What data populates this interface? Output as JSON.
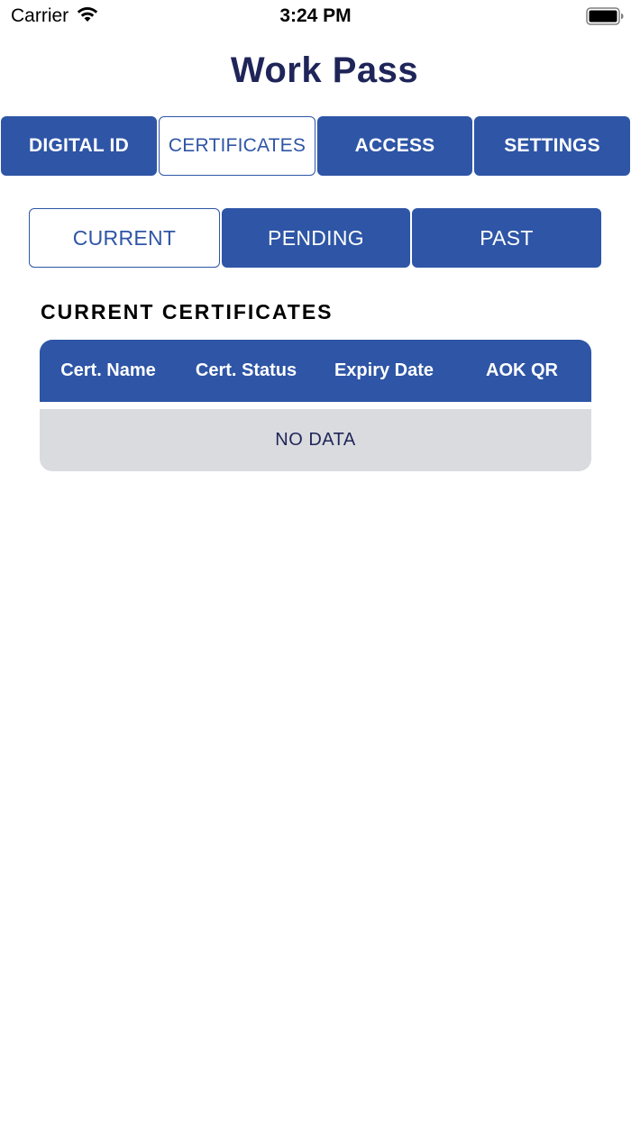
{
  "status_bar": {
    "carrier": "Carrier",
    "time": "3:24 PM",
    "wifi_icon": "wifi-icon",
    "battery_icon": "battery-icon"
  },
  "header": {
    "title": "Work Pass"
  },
  "main_tabs": [
    {
      "label": "DIGITAL ID",
      "active": false
    },
    {
      "label": "CERTIFICATES",
      "active": true
    },
    {
      "label": "ACCESS",
      "active": false
    },
    {
      "label": "SETTINGS",
      "active": false
    }
  ],
  "sub_tabs": [
    {
      "label": "CURRENT",
      "active": true
    },
    {
      "label": "PENDING",
      "active": false
    },
    {
      "label": "PAST",
      "active": false
    }
  ],
  "section": {
    "heading": "CURRENT CERTIFICATES"
  },
  "table": {
    "columns": [
      "Cert. Name",
      "Cert. Status",
      "Expiry Date",
      "AOK QR"
    ],
    "empty_text": "NO DATA"
  },
  "colors": {
    "primary": "#2e55a6",
    "title": "#1f2559",
    "empty_row": "#dadbde"
  }
}
